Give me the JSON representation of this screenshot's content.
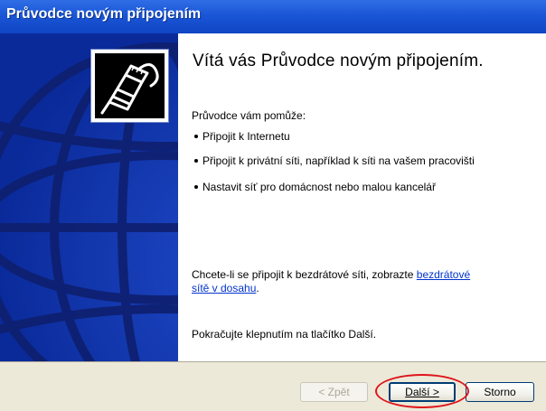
{
  "window": {
    "title": "Průvodce novým připojením"
  },
  "content": {
    "heading": "Vítá vás Průvodce novým připojením.",
    "intro": "Průvodce vám pomůže:",
    "bullets": [
      "Připojit k Internetu",
      "Připojit k privátní síti, například k síti na vašem pracovišti",
      "Nastavit síť pro domácnost nebo malou kancelář"
    ],
    "wireless_text": "Chcete-li se připojit k bezdrátové síti, zobrazte ",
    "wireless_link": "bezdrátové sítě v dosahu",
    "wireless_end": ".",
    "continue_text": "Pokračujte klepnutím na tlačítko Další."
  },
  "buttons": {
    "back": "< Zpět",
    "next": "Další >",
    "cancel": "Storno"
  },
  "icons": {
    "wizard": "network-cable-icon",
    "background": "globe-graphic"
  },
  "colors": {
    "titlebar": "#1a56d6",
    "side_panel": "#0a2a9a",
    "link": "#0033cc",
    "button_bar": "#ece9d8",
    "highlight": "#e0141a"
  }
}
